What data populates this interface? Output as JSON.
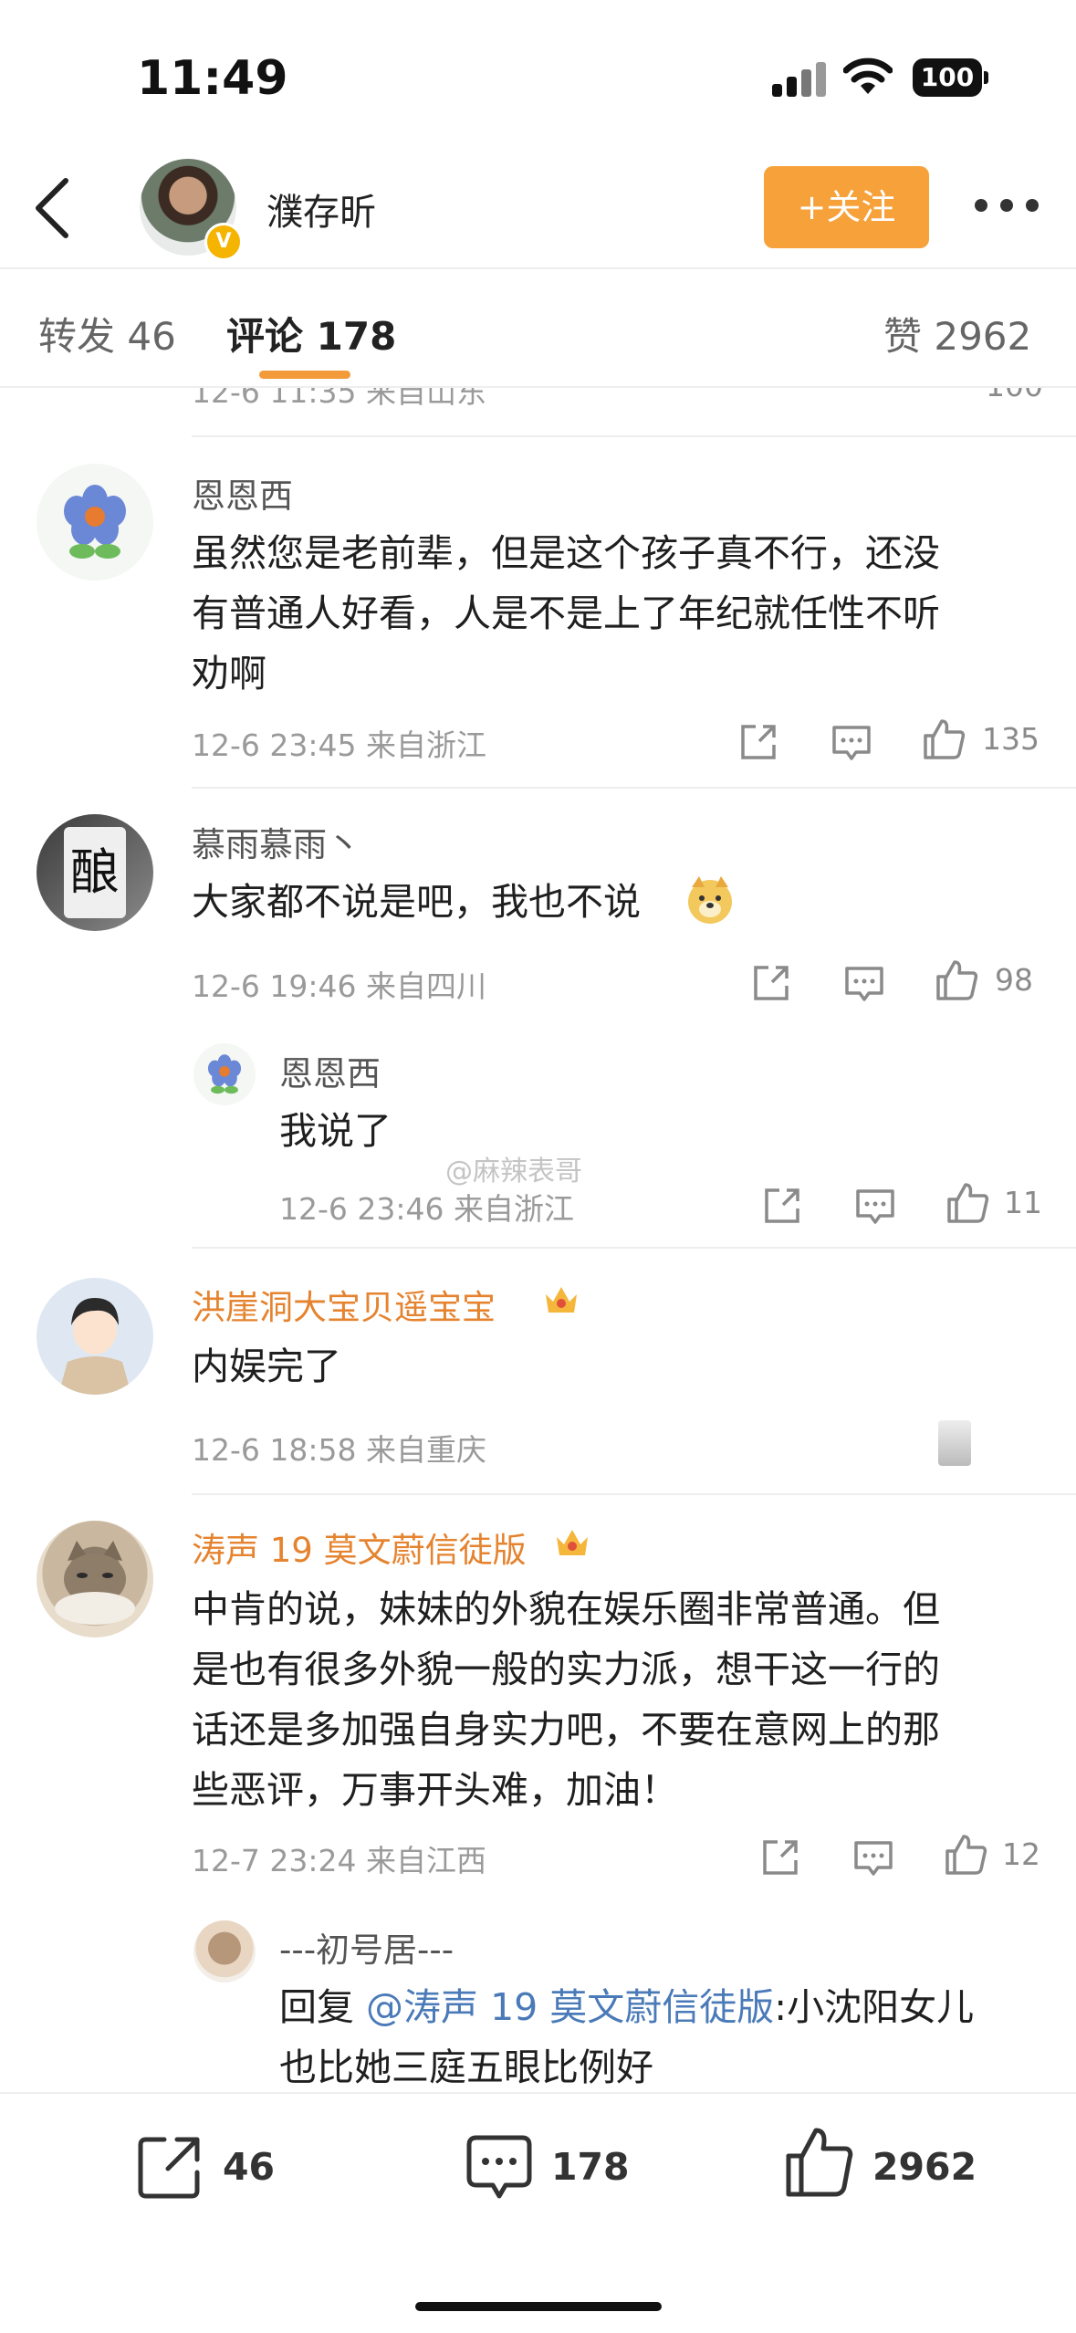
{
  "status_bar": {
    "time": "11:49",
    "battery": "100"
  },
  "header": {
    "username": "濮存昕",
    "follow_label": "+关注",
    "verified_badge": "V"
  },
  "tabs": {
    "repost": "转发 46",
    "comments": "评论 178",
    "likes": "赞 2962"
  },
  "partial_row": {
    "meta": "12-6 11:35 来自山东",
    "likes": "100"
  },
  "comments": [
    {
      "user": "恩恩西",
      "text_lines": [
        "虽然您是老前辈，但是这个孩子真不行，还没",
        "有普通人好看，人是不是上了年纪就任性不听",
        "劝啊"
      ],
      "meta": "12-6 23:45 来自浙江",
      "likes": "135"
    },
    {
      "user": "慕雨慕雨丶",
      "text": "大家都不说是吧，我也不说",
      "meta": "12-6 19:46 来自四川",
      "likes": "98",
      "reply": {
        "user": "恩恩西",
        "text": "我说了",
        "meta": "12-6 23:46 来自浙江",
        "likes": "11"
      }
    },
    {
      "user": "洪崖洞大宝贝遥宝宝",
      "text": "内娱完了",
      "meta": "12-6 18:58 来自重庆"
    },
    {
      "user": "涛声 19 莫文蔚信徒版",
      "text_lines": [
        "中肯的说，妹妹的外貌在娱乐圈非常普通。但",
        "是也有很多外貌一般的实力派，想干这一行的",
        "话还是多加强自身实力吧，不要在意网上的那",
        "些恶评，万事开头难，加油！"
      ],
      "meta": "12-7 23:24 来自江西",
      "likes": "12",
      "reply": {
        "user": "---初号居---",
        "prefix": "回复 ",
        "mention": "@涛声 19 莫文蔚信徒版",
        "text_rest": ":小沈阳女儿",
        "text_line2": "也比她三庭五眼比例好"
      }
    }
  ],
  "watermark": "@麻辣表哥",
  "bottom_bar": {
    "repost_count": "46",
    "comment_count": "178",
    "like_count": "2962"
  },
  "colors": {
    "accent": "#f39a3a",
    "follow_button": "#f6a13a",
    "vip_name": "#e5832f",
    "mention": "#4a7ab8"
  }
}
